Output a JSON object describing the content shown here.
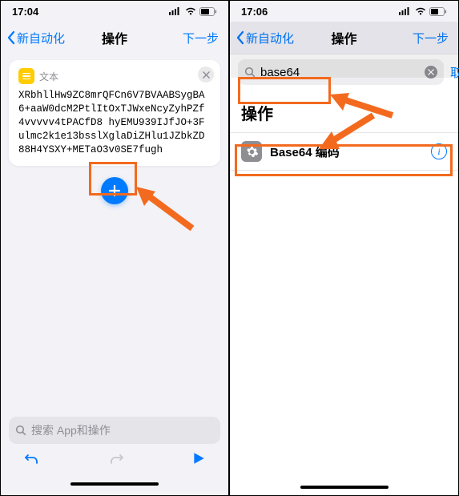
{
  "left": {
    "status": {
      "time": "17:04"
    },
    "nav": {
      "back": "新自动化",
      "title": "操作",
      "next": "下一步"
    },
    "textAction": {
      "label": "文本",
      "content": "XRbhllHw9ZC8mrQFCn6V7BVAABSygBA6+aaW0dcM2PtlItOxTJWxeNcyZyhPZf4vvvvv4tPACfD8\nhyEMU939IJfJO+3Fulmc2k1e13bsslXglaDiZHlu1JZbkZD88H4YSXY+METaO3v0SE7fugh"
    },
    "search": {
      "placeholder": "搜索 App和操作"
    }
  },
  "right": {
    "status": {
      "time": "17:06"
    },
    "nav": {
      "back": "新自动化",
      "title": "操作",
      "next": "下一步"
    },
    "search": {
      "value": "base64",
      "cancel": "取消"
    },
    "sectionTitle": "操作",
    "results": [
      {
        "label": "Base64 编码"
      }
    ]
  }
}
